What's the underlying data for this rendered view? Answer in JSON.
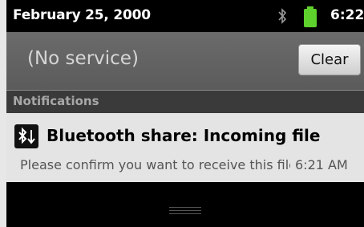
{
  "status_bar": {
    "date": "February 25, 2000",
    "time": "6:22",
    "icons": [
      "bluetooth-icon",
      "battery-icon"
    ],
    "battery_color": "#5fd12d"
  },
  "carrier": {
    "label": "(No service)",
    "clear_label": "Clear"
  },
  "notifications": {
    "header": "Notifications",
    "items": [
      {
        "icon": "bluetooth-share-icon",
        "title": "Bluetooth share: Incoming file",
        "text": "Please confirm you want to receive this file",
        "time": "6:21 AM"
      }
    ]
  }
}
